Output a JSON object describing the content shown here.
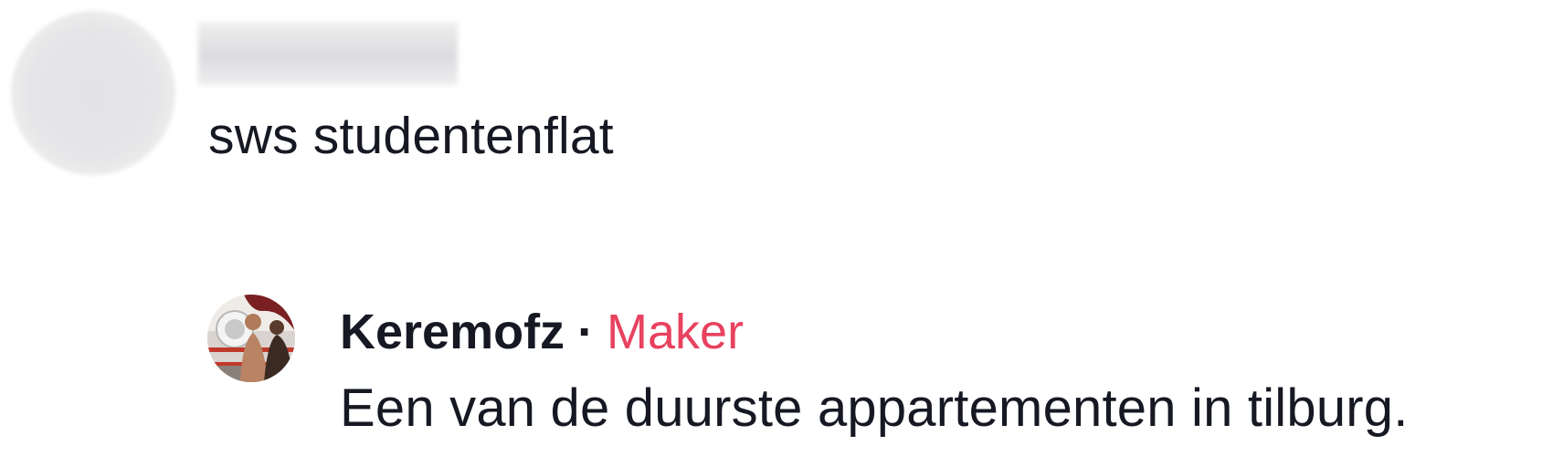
{
  "comment": {
    "avatar_icon": "blurred-avatar",
    "username": "",
    "text": "sws studentenflat"
  },
  "reply": {
    "avatar_icon": "user-photo-avatar",
    "username": "Keremofz",
    "separator": "·",
    "badge": "Maker",
    "badge_color": "#e8425f",
    "text": "Een van de duurste appartementen in tilburg."
  }
}
